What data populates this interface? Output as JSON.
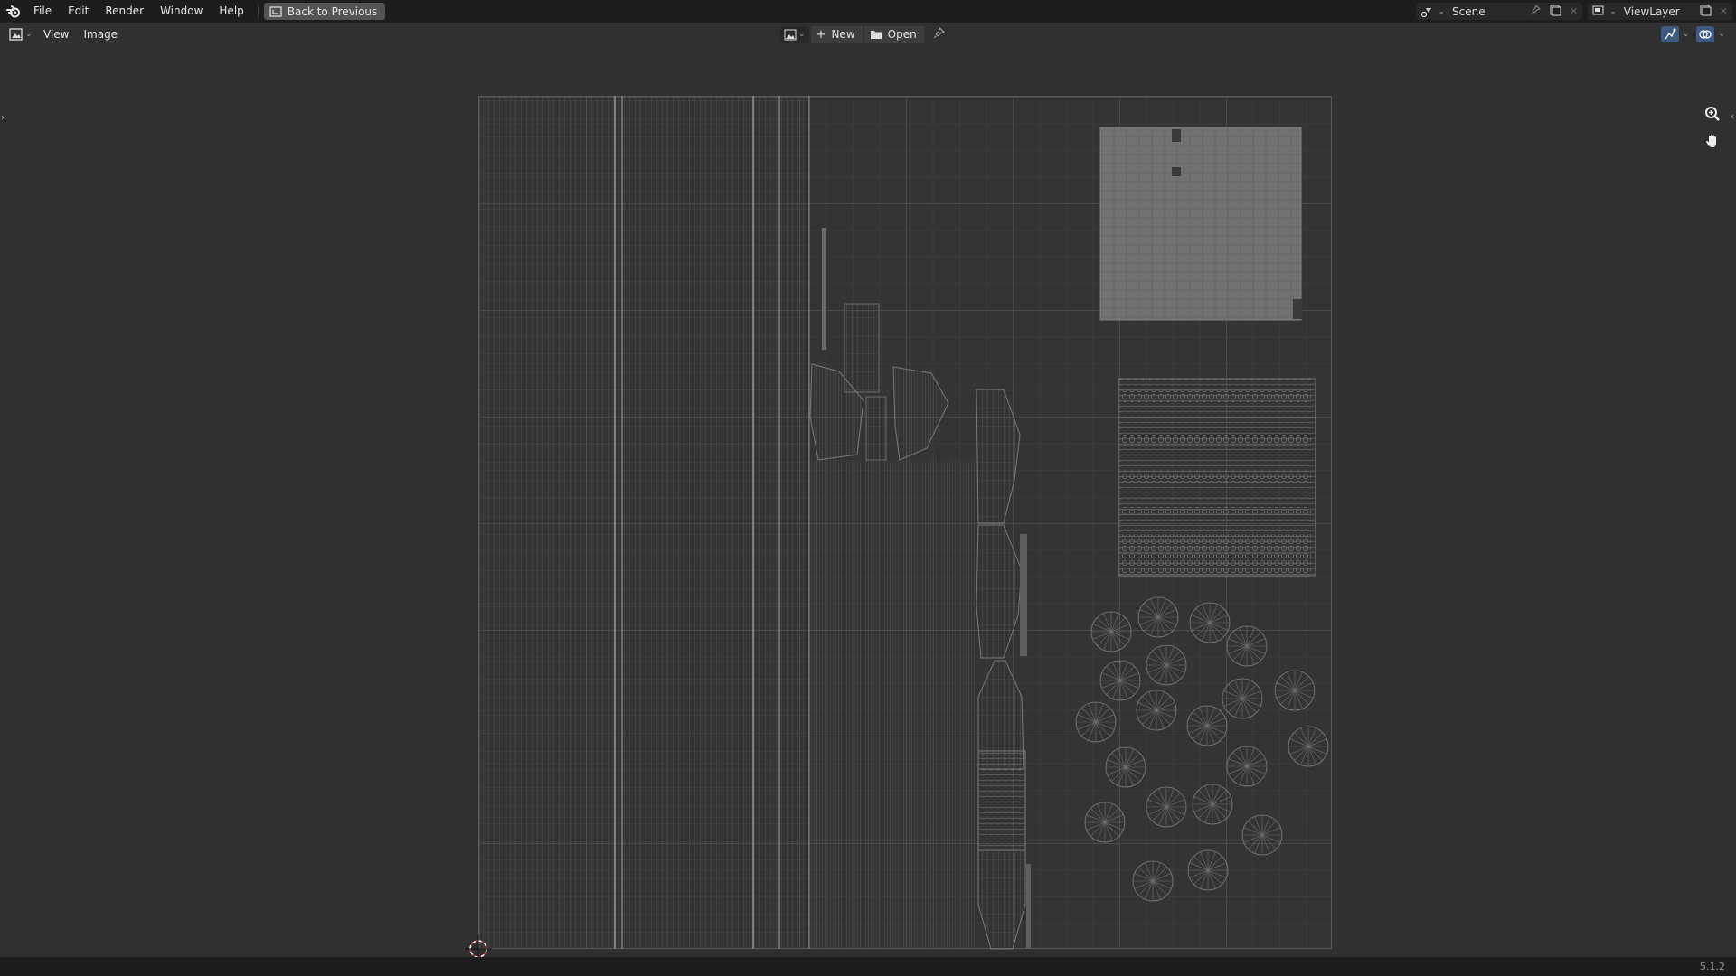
{
  "app": {
    "menu": [
      "File",
      "Edit",
      "Render",
      "Window",
      "Help"
    ],
    "back_button": "Back to Previous",
    "scene": "Scene",
    "view_layer": "ViewLayer"
  },
  "editor": {
    "menus": [
      "View",
      "Image"
    ],
    "new_label": "New",
    "open_label": "Open"
  },
  "status": {
    "version": "5.1.2"
  },
  "icons": {
    "logo": "blender-logo-icon",
    "zoom": "zoom-icon",
    "pan": "hand-icon"
  }
}
